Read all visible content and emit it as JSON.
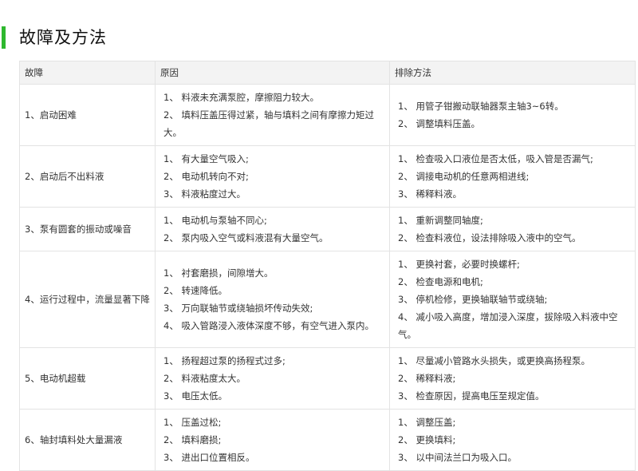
{
  "heading": {
    "title": "故障及方法",
    "accent_color": "#2eb82e"
  },
  "table": {
    "headers": [
      "故障",
      "原因",
      "排除方法"
    ],
    "rows": [
      {
        "fault": "1、启动困难",
        "causes": [
          "1、 料液未充满泵腔，摩擦阻力较大。",
          "2、 填料压盖压得过紧，轴与填料之间有摩擦力矩过大。"
        ],
        "remedies": [
          "1、 用管子钳搬动联轴器泵主轴3~6转。",
          "2、 调整填料压盖。"
        ]
      },
      {
        "fault": "2、启动后不出料液",
        "causes": [
          "1、 有大量空气吸入;",
          "2、 电动机转向不对;",
          "3、 料液粘度过大。"
        ],
        "remedies": [
          "1、 检查吸入口液位是否太低，吸入管是否漏气;",
          "2、 调接电动机的任意两相进线;",
          "3、 稀释料液。"
        ]
      },
      {
        "fault": "3、泵有圆套的振动或噪音",
        "causes": [
          "1、 电动机与泵轴不同心;",
          "2、 泵内吸入空气或料液混有大量空气。"
        ],
        "remedies": [
          "1、 重新调整同轴度;",
          "2、 检查料液位，设法排除吸入液中的空气。"
        ]
      },
      {
        "fault": "4、运行过程中，流量显著下降",
        "causes": [
          "1、 衬套磨损，间隙增大。",
          "2、 转速降低。",
          "3、 万向联轴节或绕轴损坏传动失效;",
          "4、 吸入管路浸入液体深度不够，有空气进入泵内。"
        ],
        "remedies": [
          "1、 更换衬套，必要时换螺杆;",
          "2、 检查电源和电机;",
          "3、 停机检修，更换轴联轴节或绕轴;",
          "4、 减小吸入高度，增加浸入深度，拔除吸入料液中空气。"
        ]
      },
      {
        "fault": "5、电动机超载",
        "causes": [
          "1、 扬程超过泵的扬程式过多;",
          "2、 料液粘度太大。",
          "3、 电压太低。"
        ],
        "remedies": [
          "1、 尽量减小管路水头损失，或更换高扬程泵。",
          "2、 稀释料液;",
          "3、 检查原因，提高电压至规定值。"
        ]
      },
      {
        "fault": "6、轴封填料处大量漏液",
        "causes": [
          "1、 压盖过松;",
          "2、 填料磨损;",
          "3、 进出口位置相反。"
        ],
        "remedies": [
          "1、 调整压盖;",
          "2、 更换填料;",
          "3、 以中间法兰口为吸入口。"
        ]
      }
    ]
  }
}
